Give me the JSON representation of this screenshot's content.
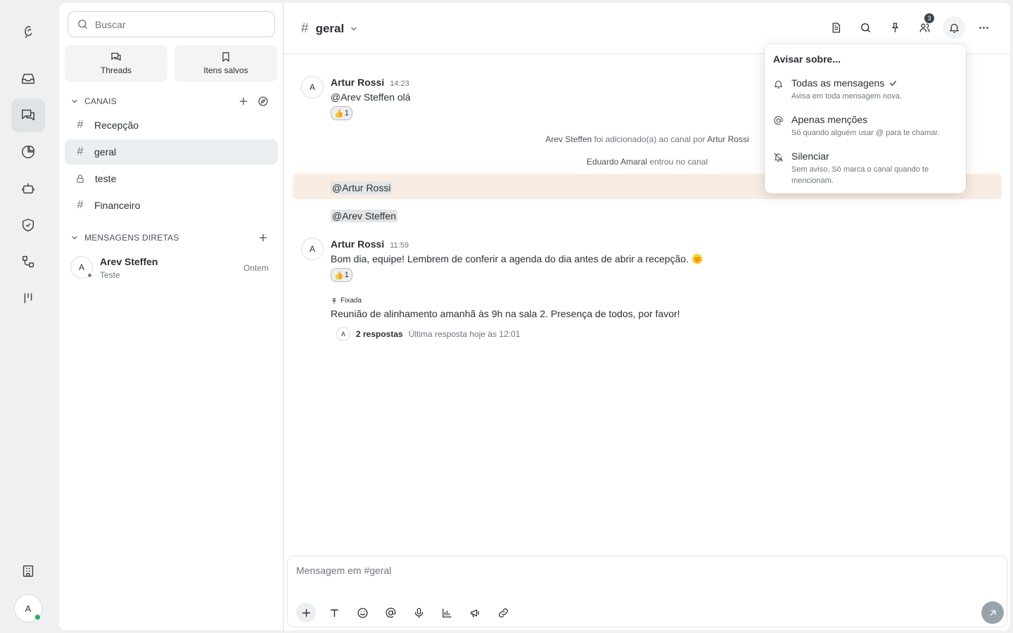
{
  "sidebar": {
    "search_placeholder": "Buscar",
    "quick": [
      {
        "label": "Threads",
        "icon": "threads-icon"
      },
      {
        "label": "Itens salvos",
        "icon": "bookmark-icon"
      }
    ],
    "channels_header": "CANAIS",
    "channels": [
      {
        "name": "Recepção",
        "type": "public",
        "active": false
      },
      {
        "name": "geral",
        "type": "public",
        "active": true
      },
      {
        "name": "teste",
        "type": "private",
        "active": false
      },
      {
        "name": "Financeiro",
        "type": "public",
        "active": false
      }
    ],
    "dm_header": "MENSAGENS DIRETAS",
    "dms": [
      {
        "initial": "A",
        "name": "Arev Steffen",
        "subtitle": "Teste",
        "when": "Ontem"
      }
    ]
  },
  "rail": {
    "user_initial": "A",
    "status_color": "#21b35b"
  },
  "header": {
    "channel_hash": "#",
    "channel_name": "geral",
    "members_badge": "3"
  },
  "messages": {
    "m1": {
      "initial": "A",
      "author": "Artur Rossi",
      "time": "14:23",
      "text": "@Arev Steffen olá",
      "reaction": "👍",
      "reaction_count": "1"
    },
    "sys1": {
      "subject": "Arev Steffen",
      "action": " foi adicionado(a) ao canal por ",
      "object": "Artur Rossi"
    },
    "sys2": {
      "subject": "Eduardo Amaral",
      "action": " entrou no canal"
    },
    "mention1": "@Artur Rossi",
    "mention2": "@Arev Steffen",
    "m2": {
      "initial": "A",
      "author": "Artur Rossi",
      "time": "11:59",
      "text": "Bom dia, equipe! Lembrem de conferir a agenda do dia antes de abrir a recepção. 🌞",
      "reaction": "👍",
      "reaction_count": "1"
    },
    "pinned_label": "Fixada",
    "pinned_text": "Reunião de alinhamento amanhã às 9h na sala 2. Presença de todos, por favor!",
    "thread": {
      "initial": "A",
      "count": "2 respostas",
      "last": "Última resposta hoje às 12:01"
    }
  },
  "composer": {
    "placeholder": "Mensagem em #geral"
  },
  "notify_menu": {
    "title": "Avisar sobre...",
    "options": [
      {
        "label": "Todas as mensagens",
        "desc": "Avisa em toda mensagem nova.",
        "selected": true
      },
      {
        "label": "Apenas menções",
        "desc": "Só quando alguém usar @ para te chamar.",
        "selected": false
      },
      {
        "label": "Silenciar",
        "desc": "Sem aviso. Só marca o canal quando te mencionam.",
        "selected": false
      }
    ]
  },
  "colors": {
    "mention_highlight": "#f9ede3",
    "accent_dark": "#2b3033",
    "online": "#21b35b"
  }
}
